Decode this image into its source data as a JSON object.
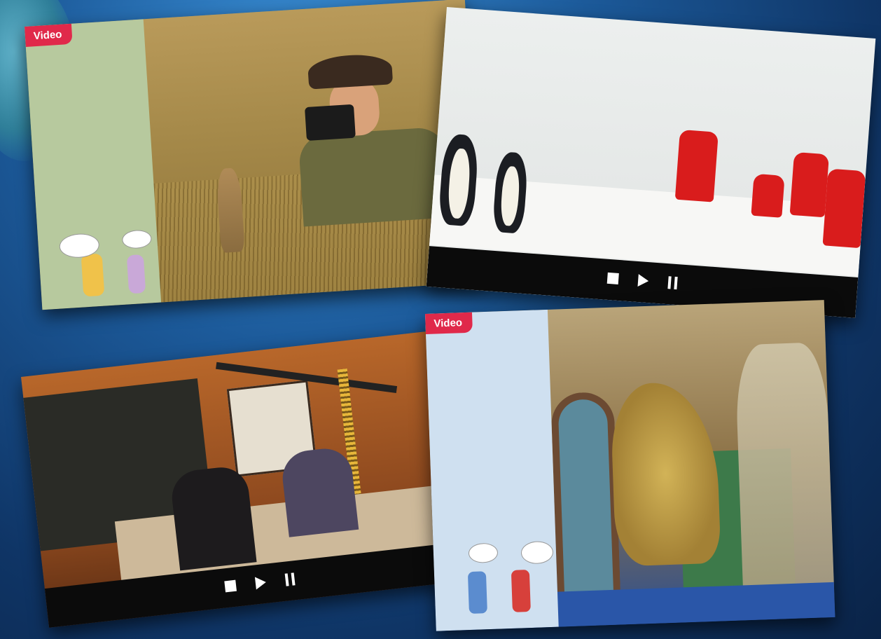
{
  "cards": {
    "meerkat": {
      "tab": "Video"
    },
    "museum": {
      "tab": "Video"
    }
  },
  "player_controls": {
    "stop_icon": "stop-icon",
    "play_icon": "play-icon",
    "pause_icon": "pause-icon"
  }
}
